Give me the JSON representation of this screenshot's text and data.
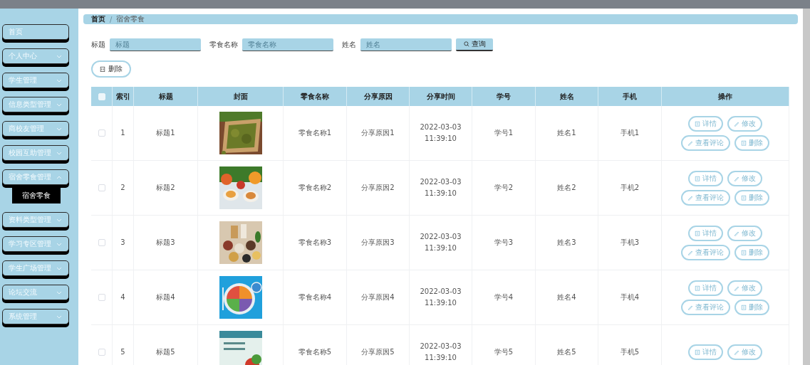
{
  "sidebar": {
    "items": [
      {
        "label": "首页"
      },
      {
        "label": "个人中心",
        "expanded": false
      },
      {
        "label": "学生管理",
        "expanded": false
      },
      {
        "label": "信息类型管理",
        "expanded": false
      },
      {
        "label": "商校友管理",
        "expanded": false
      },
      {
        "label": "校园互助管理",
        "expanded": false
      },
      {
        "label": "宿舍零食管理",
        "expanded": true,
        "children": [
          {
            "label": "宿舍零食",
            "selected": true
          }
        ]
      },
      {
        "label": "资料类型管理",
        "expanded": false
      },
      {
        "label": "学习专区管理",
        "expanded": false
      },
      {
        "label": "学生广场管理",
        "expanded": false
      },
      {
        "label": "论坛交流",
        "expanded": false
      },
      {
        "label": "系统管理",
        "expanded": false
      }
    ]
  },
  "breadcrumb": {
    "items": [
      "首页",
      "宿舍零食"
    ],
    "separator": "/"
  },
  "search": {
    "fields": [
      {
        "label": "标题",
        "placeholder": "标题"
      },
      {
        "label": "零食名称",
        "placeholder": "零食名称"
      },
      {
        "label": "姓名",
        "placeholder": "姓名"
      }
    ],
    "button": "查询"
  },
  "delete_button": "删除",
  "table": {
    "select_all_checked": false,
    "columns": [
      "索引",
      "标题",
      "封面",
      "零食名称",
      "分享原因",
      "分享时间",
      "学号",
      "姓名",
      "手机",
      "操作"
    ],
    "rows": [
      {
        "checked": false,
        "index": "1",
        "title": "标题1",
        "cover": {
          "kind": "picture"
        },
        "name": "零食名称1",
        "reason": "分享原因1",
        "time": "2022-03-03 11:39:10",
        "student_no": "学号1",
        "person": "姓名1",
        "phone": "手机1",
        "actions": [
          {
            "kind": "detail",
            "label": "详情"
          },
          {
            "kind": "edit",
            "label": "修改"
          },
          {
            "kind": "comments",
            "label": "查看评论"
          },
          {
            "kind": "delete",
            "label": "删除"
          }
        ]
      },
      {
        "checked": false,
        "index": "2",
        "title": "标题2",
        "cover": {
          "kind": "picture"
        },
        "name": "零食名称2",
        "reason": "分享原因2",
        "time": "2022-03-03 11:39:10",
        "student_no": "学号2",
        "person": "姓名2",
        "phone": "手机2",
        "actions": [
          {
            "kind": "detail",
            "label": "详情"
          },
          {
            "kind": "edit",
            "label": "修改"
          },
          {
            "kind": "comments",
            "label": "查看评论"
          },
          {
            "kind": "delete",
            "label": "删除"
          }
        ]
      },
      {
        "checked": false,
        "index": "3",
        "title": "标题3",
        "cover": {
          "kind": "picture"
        },
        "name": "零食名称3",
        "reason": "分享原因3",
        "time": "2022-03-03 11:39:10",
        "student_no": "学号3",
        "person": "姓名3",
        "phone": "手机3",
        "actions": [
          {
            "kind": "detail",
            "label": "详情"
          },
          {
            "kind": "edit",
            "label": "修改"
          },
          {
            "kind": "comments",
            "label": "查看评论"
          },
          {
            "kind": "delete",
            "label": "删除"
          }
        ]
      },
      {
        "checked": false,
        "index": "4",
        "title": "标题4",
        "cover": {
          "kind": "picture"
        },
        "name": "零食名称4",
        "reason": "分享原因4",
        "time": "2022-03-03 11:39:10",
        "student_no": "学号4",
        "person": "姓名4",
        "phone": "手机4",
        "actions": [
          {
            "kind": "detail",
            "label": "详情"
          },
          {
            "kind": "edit",
            "label": "修改"
          },
          {
            "kind": "comments",
            "label": "查看评论"
          },
          {
            "kind": "delete",
            "label": "删除"
          }
        ]
      },
      {
        "checked": false,
        "index": "5",
        "title": "标题5",
        "cover": {
          "kind": "picture"
        },
        "name": "零食名称5",
        "reason": "分享原因5",
        "time": "2022-03-03 11:39:10",
        "student_no": "学号5",
        "person": "姓名5",
        "phone": "手机5",
        "actions": [
          {
            "kind": "detail",
            "label": "详情"
          },
          {
            "kind": "edit",
            "label": "修改"
          }
        ]
      }
    ]
  }
}
